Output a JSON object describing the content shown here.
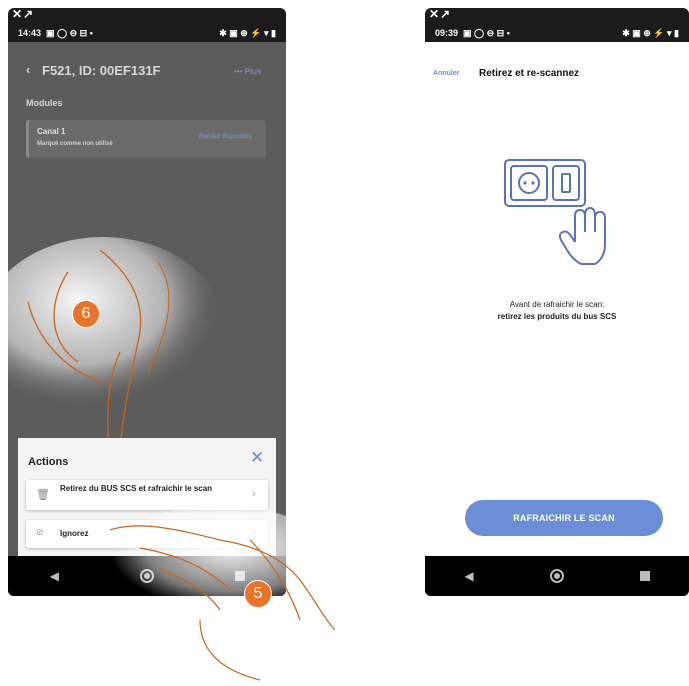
{
  "left_phone": {
    "status_time": "14:43",
    "header_title": "F521, ID: 00EF131F",
    "header_more": "••• Plus",
    "section_title": "Modules",
    "module": {
      "name": "Canal 1",
      "status": "Marqué comme non utilisé",
      "action": "Rendez disponible"
    },
    "actions_sheet": {
      "title": "Actions",
      "options": [
        {
          "label": "Retirez du BUS SCS et rafraichir le scan",
          "icon": "trash-icon"
        },
        {
          "label": "Ignorez",
          "icon": "eye-off-icon"
        }
      ]
    },
    "callouts": [
      "6",
      "5"
    ]
  },
  "right_phone": {
    "status_time": "09:39",
    "cancel_label": "Annuler",
    "title": "Retirez et re-scannez",
    "instruction_line1": "Avant de rafraichir le scan:",
    "instruction_line2": "retirez les produits du bus SCS",
    "refresh_button": "RAFRAICHIR LE SCAN"
  },
  "colors": {
    "accent": "#6b8ed6",
    "callout": "#e8732a",
    "dim_overlay": "#5c5c5c"
  }
}
